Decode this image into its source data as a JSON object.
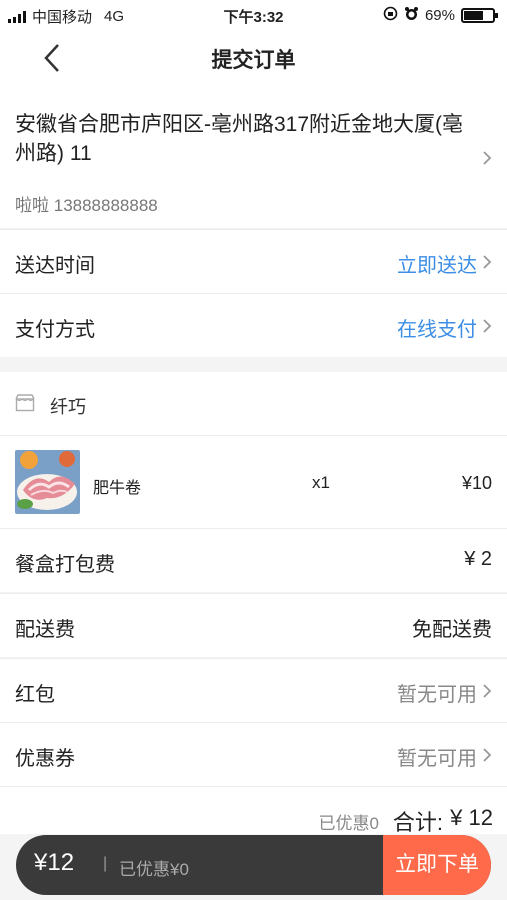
{
  "status_bar": {
    "carrier": "中国移动",
    "network": "4G",
    "time": "下午3:32",
    "battery": "69%",
    "battery_level": 0.69
  },
  "nav": {
    "title": "提交订单",
    "back_icon": "back-arrow-icon"
  },
  "address": {
    "text": "安徽省合肥市庐阳区-亳州路317附近金地大厦(亳州路) 11",
    "contact_name": "啦啦",
    "contact_phone": "13888888888"
  },
  "delivery": {
    "label": "送达时间",
    "value": "立即送达"
  },
  "payment": {
    "label": "支付方式",
    "value": "在线支付"
  },
  "shop": {
    "icon": "shop-icon",
    "name": "纤巧"
  },
  "products": [
    {
      "name": "肥牛卷",
      "qty": "x1",
      "price": "¥10"
    }
  ],
  "fees": {
    "packaging_label": "餐盒打包费",
    "packaging_value": "¥ 2",
    "delivery_label": "配送费",
    "delivery_value": "免配送费",
    "redpacket_label": "红包",
    "redpacket_value": "暂无可用",
    "coupon_label": "优惠券",
    "coupon_value": "暂无可用"
  },
  "summary": {
    "discount": "已优惠0",
    "total_label": "合计:",
    "total_value": "¥ 12"
  },
  "bottom_bar": {
    "price": "¥12",
    "separator": "|",
    "saved": "已优惠¥0",
    "order_button": "立即下单"
  },
  "colors": {
    "accent_blue": "#3d8ee5",
    "order_button": "#ff6a4a",
    "bottom_bar": "#3a3a3a"
  }
}
